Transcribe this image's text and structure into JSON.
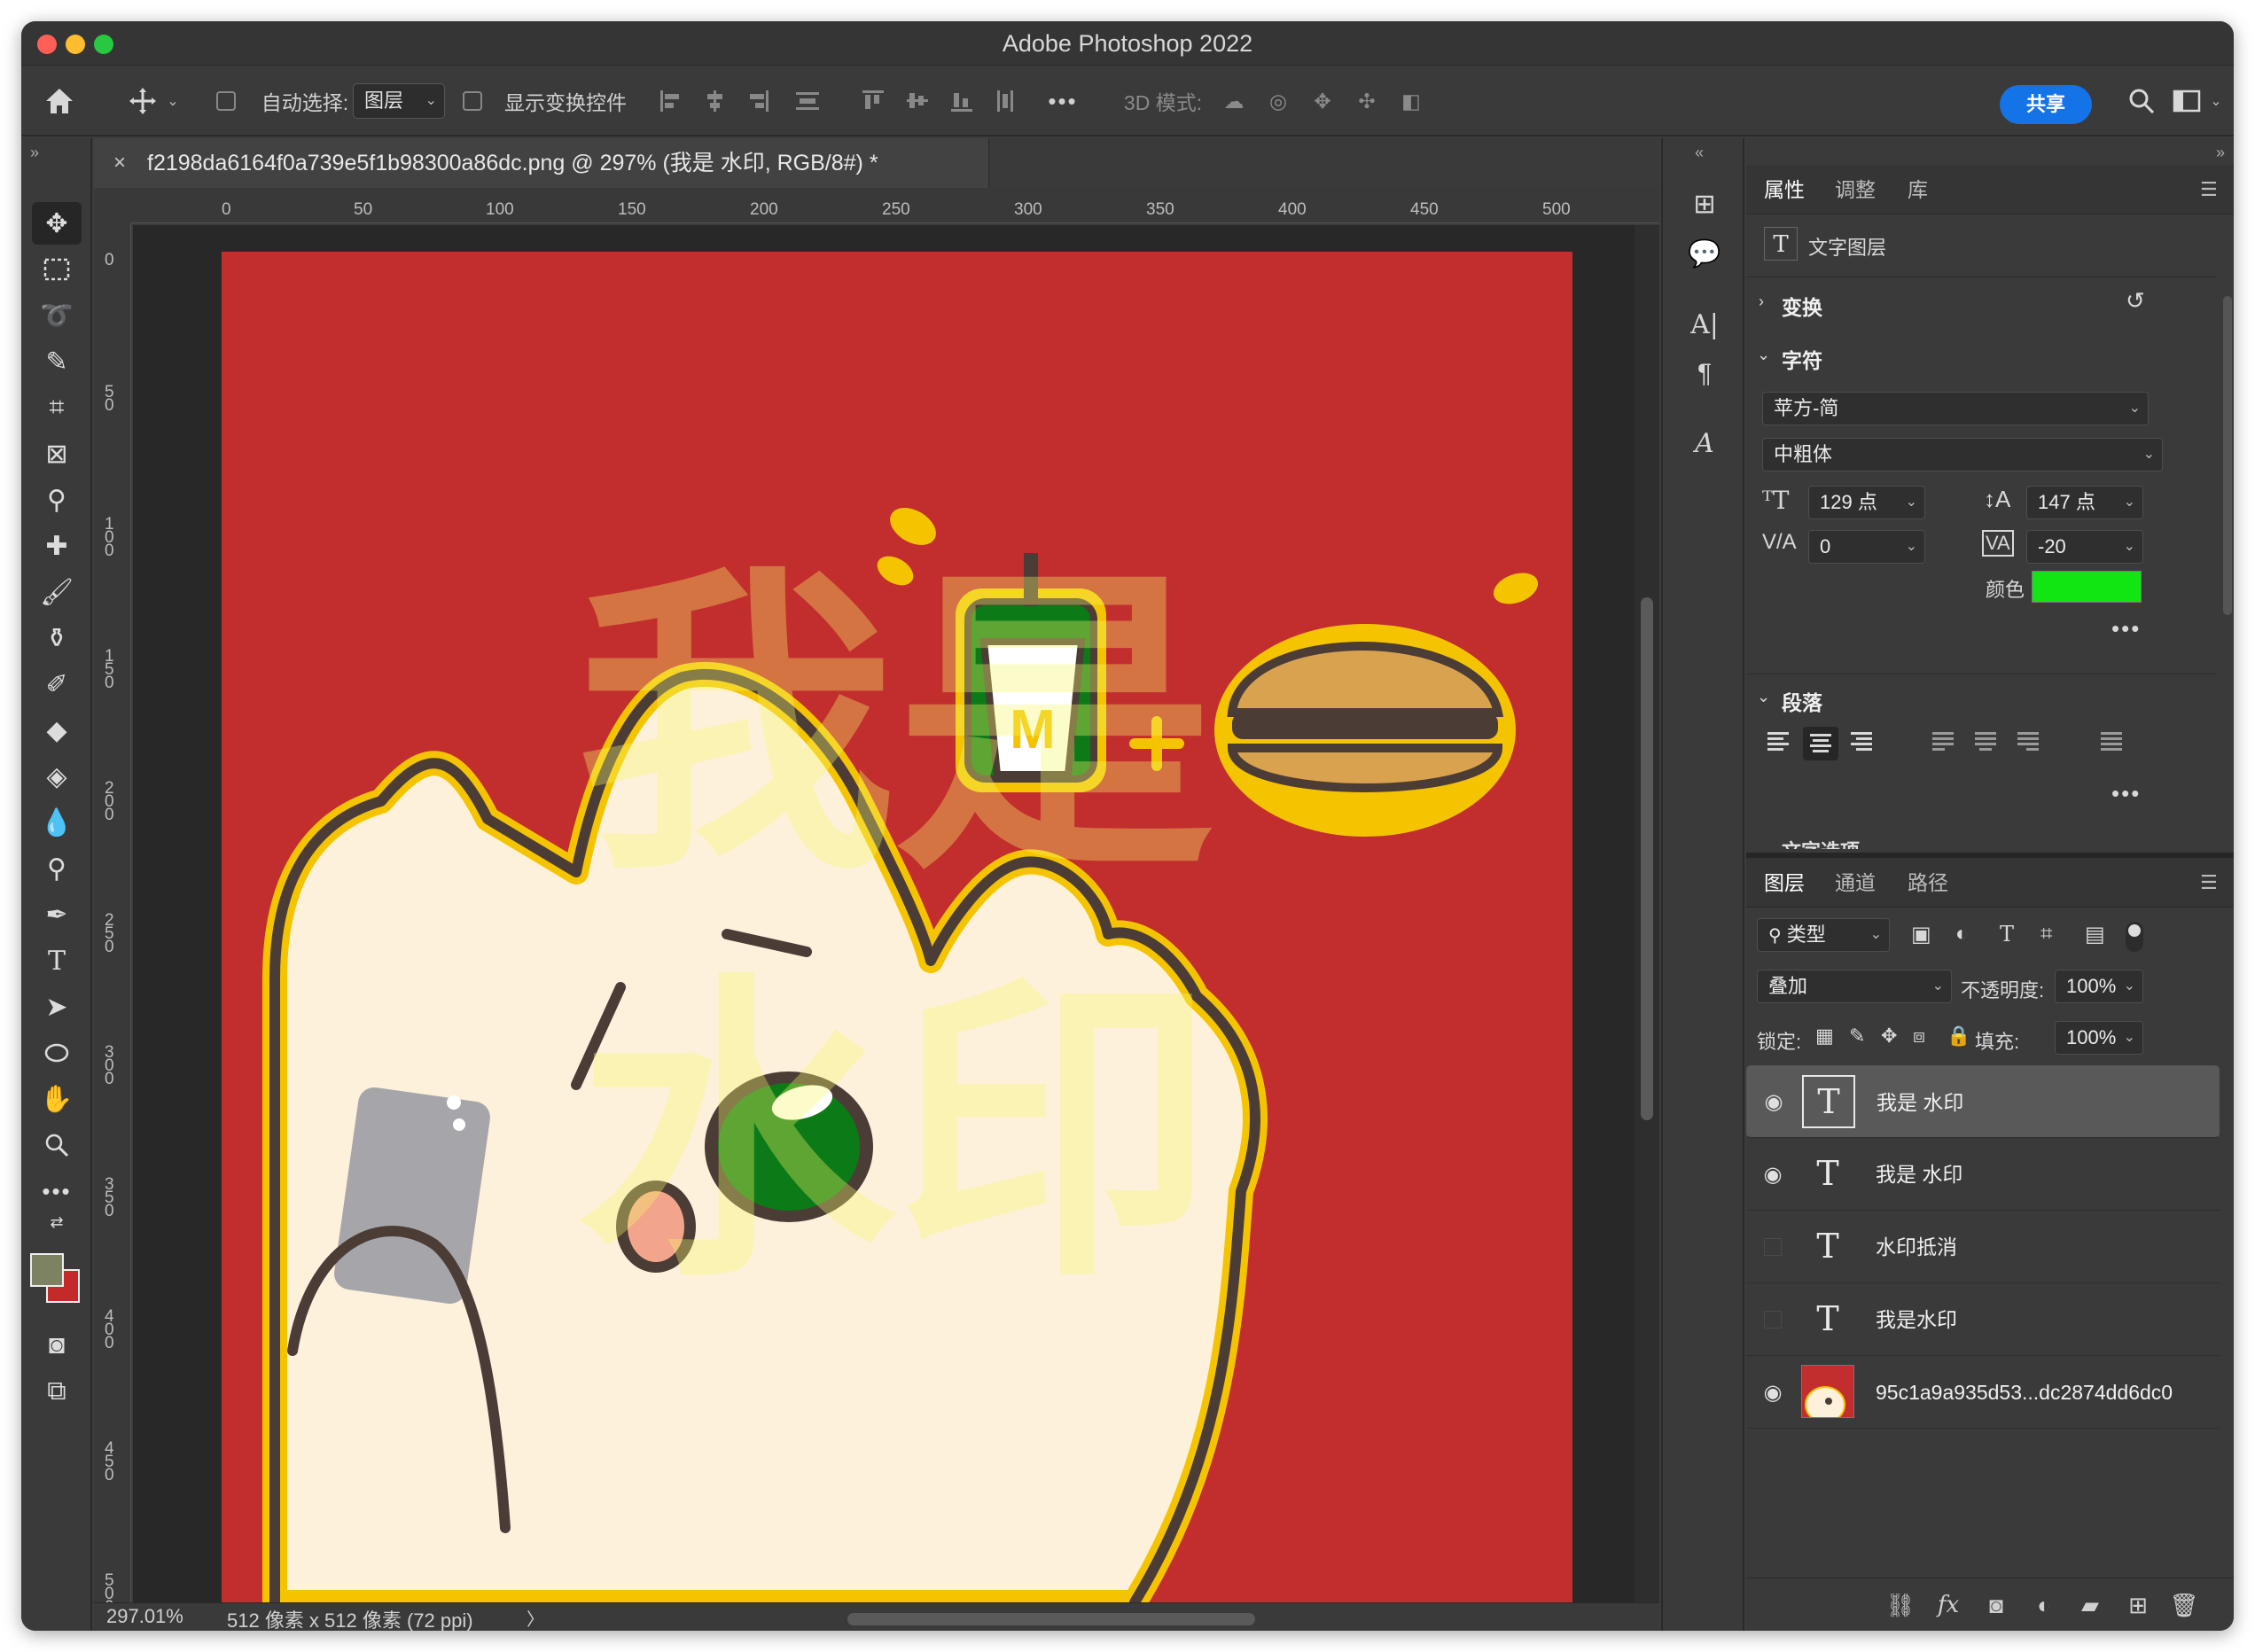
{
  "window": {
    "title": "Adobe Photoshop 2022"
  },
  "options_bar": {
    "auto_select_label": "自动选择:",
    "auto_select_value": "图层",
    "show_transform_label": "显示变换控件",
    "mode3d_label": "3D 模式:",
    "more": "•••",
    "share_label": "共享"
  },
  "document": {
    "tab_title": "f2198da6164f0a739e5f1b98300a86dc.png @ 297% (我是 水印, RGB/8#) *",
    "tab_close": "×",
    "zoom": "297.01%",
    "info": "512 像素 x 512 像素 (72 ppi)",
    "info_arrow": "〉",
    "ruler_h": [
      "0",
      "50",
      "100",
      "150",
      "200",
      "250",
      "300",
      "350",
      "400",
      "450",
      "500"
    ],
    "ruler_v": [
      "0",
      "50",
      "100",
      "150",
      "200",
      "250",
      "300",
      "350",
      "400",
      "450",
      "500"
    ],
    "watermark_text": "我是水印"
  },
  "properties": {
    "tabs": [
      "属性",
      "调整",
      "库"
    ],
    "layer_type": "文字图层",
    "transform_label": "变换",
    "character_label": "字符",
    "font_family": "苹方-简",
    "font_style": "中粗体",
    "font_size": "129 点",
    "leading": "147 点",
    "kerning": "0",
    "tracking": "-20",
    "color_label": "颜色",
    "color_value": "#12e612",
    "paragraph_label": "段落",
    "more": "•••",
    "partial_label": "文字选项"
  },
  "layers_panel": {
    "tabs": [
      "图层",
      "通道",
      "路径"
    ],
    "filter_label": "类型",
    "blend_mode": "叠加",
    "opacity_label": "不透明度:",
    "opacity_value": "100%",
    "lock_label": "锁定:",
    "fill_label": "填充:",
    "fill_value": "100%",
    "layers": [
      {
        "name": "我是 水印",
        "visible": true,
        "type": "text",
        "selected": true
      },
      {
        "name": "我是 水印",
        "visible": true,
        "type": "text",
        "selected": false
      },
      {
        "name": "水印抵消",
        "visible": false,
        "type": "text",
        "selected": false
      },
      {
        "name": "我是水印",
        "visible": false,
        "type": "text",
        "selected": false
      },
      {
        "name": "95c1a9a935d53...dc2874dd6dc0",
        "visible": true,
        "type": "image",
        "selected": false
      }
    ]
  },
  "colors": {
    "accent": "#1473e6",
    "canvas_red": "#c22e2e",
    "text_layer_color": "#12e612"
  }
}
